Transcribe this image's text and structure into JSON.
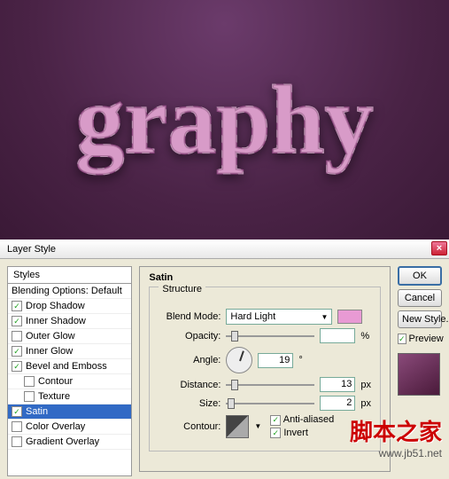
{
  "dialog": {
    "title": "Layer Style"
  },
  "styles_header": "Styles",
  "styles": {
    "blending": "Blending Options: Default",
    "drop_shadow": "Drop Shadow",
    "inner_shadow": "Inner Shadow",
    "outer_glow": "Outer Glow",
    "inner_glow": "Inner Glow",
    "bevel": "Bevel and Emboss",
    "contour": "Contour",
    "texture": "Texture",
    "satin": "Satin",
    "color_overlay": "Color Overlay",
    "gradient_overlay": "Gradient Overlay"
  },
  "panel": {
    "title": "Satin",
    "group": "Structure",
    "blend_mode_lbl": "Blend Mode:",
    "blend_mode_val": "Hard Light",
    "color": "#e89ad4",
    "opacity_lbl": "Opacity:",
    "opacity_val": " ",
    "opacity_unit": "%",
    "angle_lbl": "Angle:",
    "angle_val": "19",
    "angle_unit": "°",
    "distance_lbl": "Distance:",
    "distance_val": "13",
    "distance_unit": "px",
    "size_lbl": "Size:",
    "size_val": "2",
    "size_unit": "px",
    "contour_lbl": "Contour:",
    "anti_aliased": "Anti-aliased",
    "invert": "Invert"
  },
  "buttons": {
    "ok": "OK",
    "cancel": "Cancel",
    "new_style": "New Style...",
    "preview": "Preview"
  },
  "watermark": {
    "cn": "脚本之家",
    "url": "www.jb51.net"
  },
  "artwork": "graphy"
}
